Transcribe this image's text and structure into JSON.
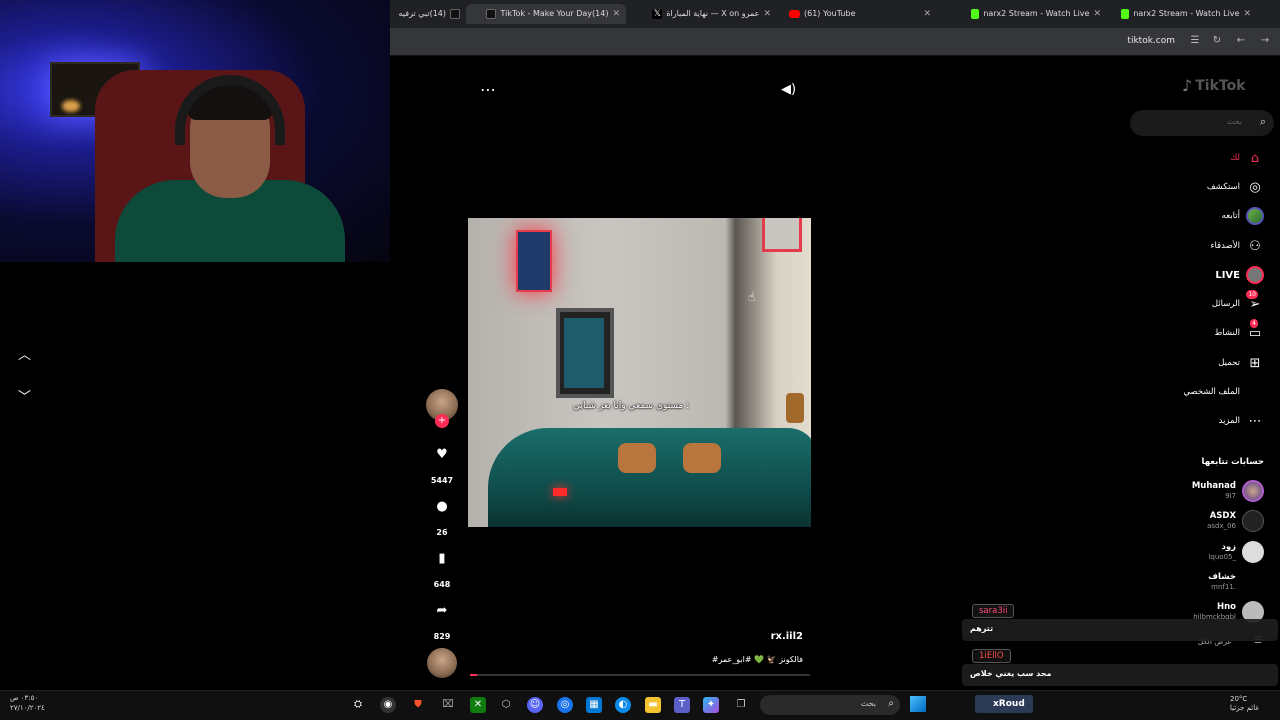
{
  "browser": {
    "tabs": [
      {
        "title": "(14)تبي ترفيه",
        "icon": "tiktok-icon"
      },
      {
        "title": "(14)TikTok - Make Your Day",
        "icon": "tiktok-icon",
        "active": true
      },
      {
        "title": "عمرو X on — نهاية المباراة",
        "icon": "x-icon"
      },
      {
        "title": "(61) YouTube",
        "icon": "youtube-icon"
      },
      {
        "title": "narx2 Stream - Watch Live",
        "icon": "kick-icon"
      },
      {
        "title": "narx2 Stream - Watch Live",
        "icon": "kick-icon"
      }
    ],
    "url": "tiktok.com"
  },
  "tiktok": {
    "logo": "TikTok",
    "search_placeholder": "بحث",
    "nav": [
      {
        "label": "لك",
        "icon": "home-icon"
      },
      {
        "label": "استكشف",
        "icon": "compass-icon"
      },
      {
        "label": "أتابعه",
        "icon": "following-avatar-icon"
      },
      {
        "label": "الأصدقاء",
        "icon": "friends-icon"
      },
      {
        "label": "LIVE",
        "icon": "live-icon"
      },
      {
        "label": "الرسائل",
        "icon": "messages-icon",
        "badge": "10"
      },
      {
        "label": "النشاط",
        "icon": "activity-icon",
        "badge": "4"
      },
      {
        "label": "تحميل",
        "icon": "upload-icon"
      },
      {
        "label": "الملف الشخصي",
        "icon": "profile-icon"
      },
      {
        "label": "المزيد",
        "icon": "more-icon"
      }
    ],
    "following_title": "حسابات تتابعها",
    "following": [
      {
        "name": "Muhanad",
        "handle": "9l7"
      },
      {
        "name": "ASDX",
        "handle": "asdx_06"
      },
      {
        "name": "زود",
        "handle": "lquo05_"
      },
      {
        "name": "خشاف",
        "handle": "mnf11."
      },
      {
        "name": "Hno",
        "handle": "hilbmckbqbl"
      }
    ],
    "see_more": "عرض الكل",
    "video": {
      "caption": "مستوى سمعي وانا بعز شبابي :",
      "author": "rx.iil2",
      "description": "#فالكونز 🦅 💚 #ابو_عمر",
      "progress": 0.02
    },
    "actions": {
      "likes": "5447",
      "comments": "26",
      "saves": "648",
      "shares": "829"
    }
  },
  "chat": [
    {
      "user": "sara3ii",
      "message": "تترهم",
      "color": "#ff4d7a"
    },
    {
      "user": "1iEllO",
      "message": "محد سب يغني خلاص",
      "color": "#ff4d4d"
    }
  ],
  "taskbar": {
    "search": "بحث",
    "kick_user": "xRoud",
    "clock_time": "٠٣:٥٠ ص",
    "clock_date": "٢٧/١٠/٢٠٢٤",
    "weather_temp": "20°C",
    "weather_desc": "غائم جزئيا"
  }
}
